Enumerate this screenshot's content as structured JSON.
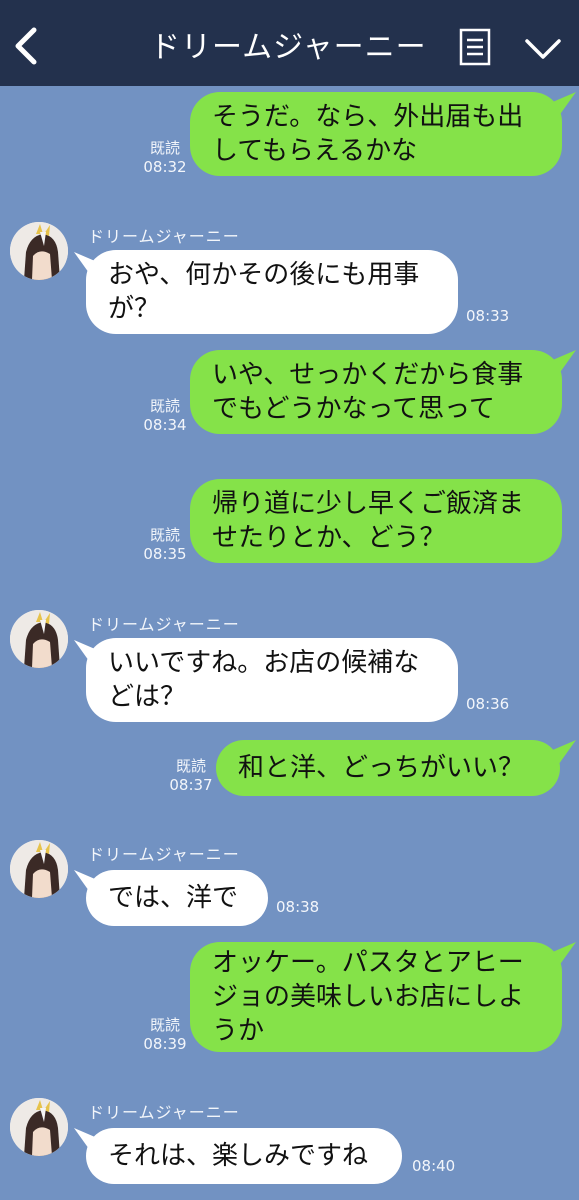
{
  "header": {
    "title": "ドリームジャーニー"
  },
  "colors": {
    "header_bg": "#23314d",
    "chat_bg": "#7292c2",
    "outgoing_bubble": "#85e249",
    "incoming_bubble": "#ffffff"
  },
  "icons": {
    "back": "chevron-left-icon",
    "menu": "menu-icon",
    "expand": "chevron-down-icon"
  },
  "messages": [
    {
      "side": "out",
      "lines": [
        "そうだ。なら、外出届も出",
        "してもらえるかな"
      ],
      "read": "既読",
      "time": "08:32"
    },
    {
      "side": "in",
      "sender": "ドリームジャーニー",
      "lines": [
        "おや、何かその後にも用事",
        "が？"
      ],
      "time": "08:33"
    },
    {
      "side": "out",
      "lines": [
        "いや、せっかくだから食事",
        "でもどうかなって思って"
      ],
      "read": "既読",
      "time": "08:34"
    },
    {
      "side": "out",
      "lines": [
        "帰り道に少し早くご飯済ま",
        "せたりとか、どう？"
      ],
      "read": "既読",
      "time": "08:35"
    },
    {
      "side": "in",
      "sender": "ドリームジャーニー",
      "lines": [
        "いいですね。お店の候補な",
        "どは？"
      ],
      "time": "08:36"
    },
    {
      "side": "out",
      "lines": [
        "和と洋、どっちがいい？"
      ],
      "read": "既読",
      "time": "08:37"
    },
    {
      "side": "in",
      "sender": "ドリームジャーニー",
      "lines": [
        "では、洋で"
      ],
      "time": "08:38"
    },
    {
      "side": "out",
      "lines": [
        "オッケー。パスタとアヒー",
        "ジョの美味しいお店にしよ",
        "うか"
      ],
      "read": "既読",
      "time": "08:39"
    },
    {
      "side": "in",
      "sender": "ドリームジャーニー",
      "lines": [
        "それは、楽しみですね"
      ],
      "time": "08:40"
    }
  ]
}
